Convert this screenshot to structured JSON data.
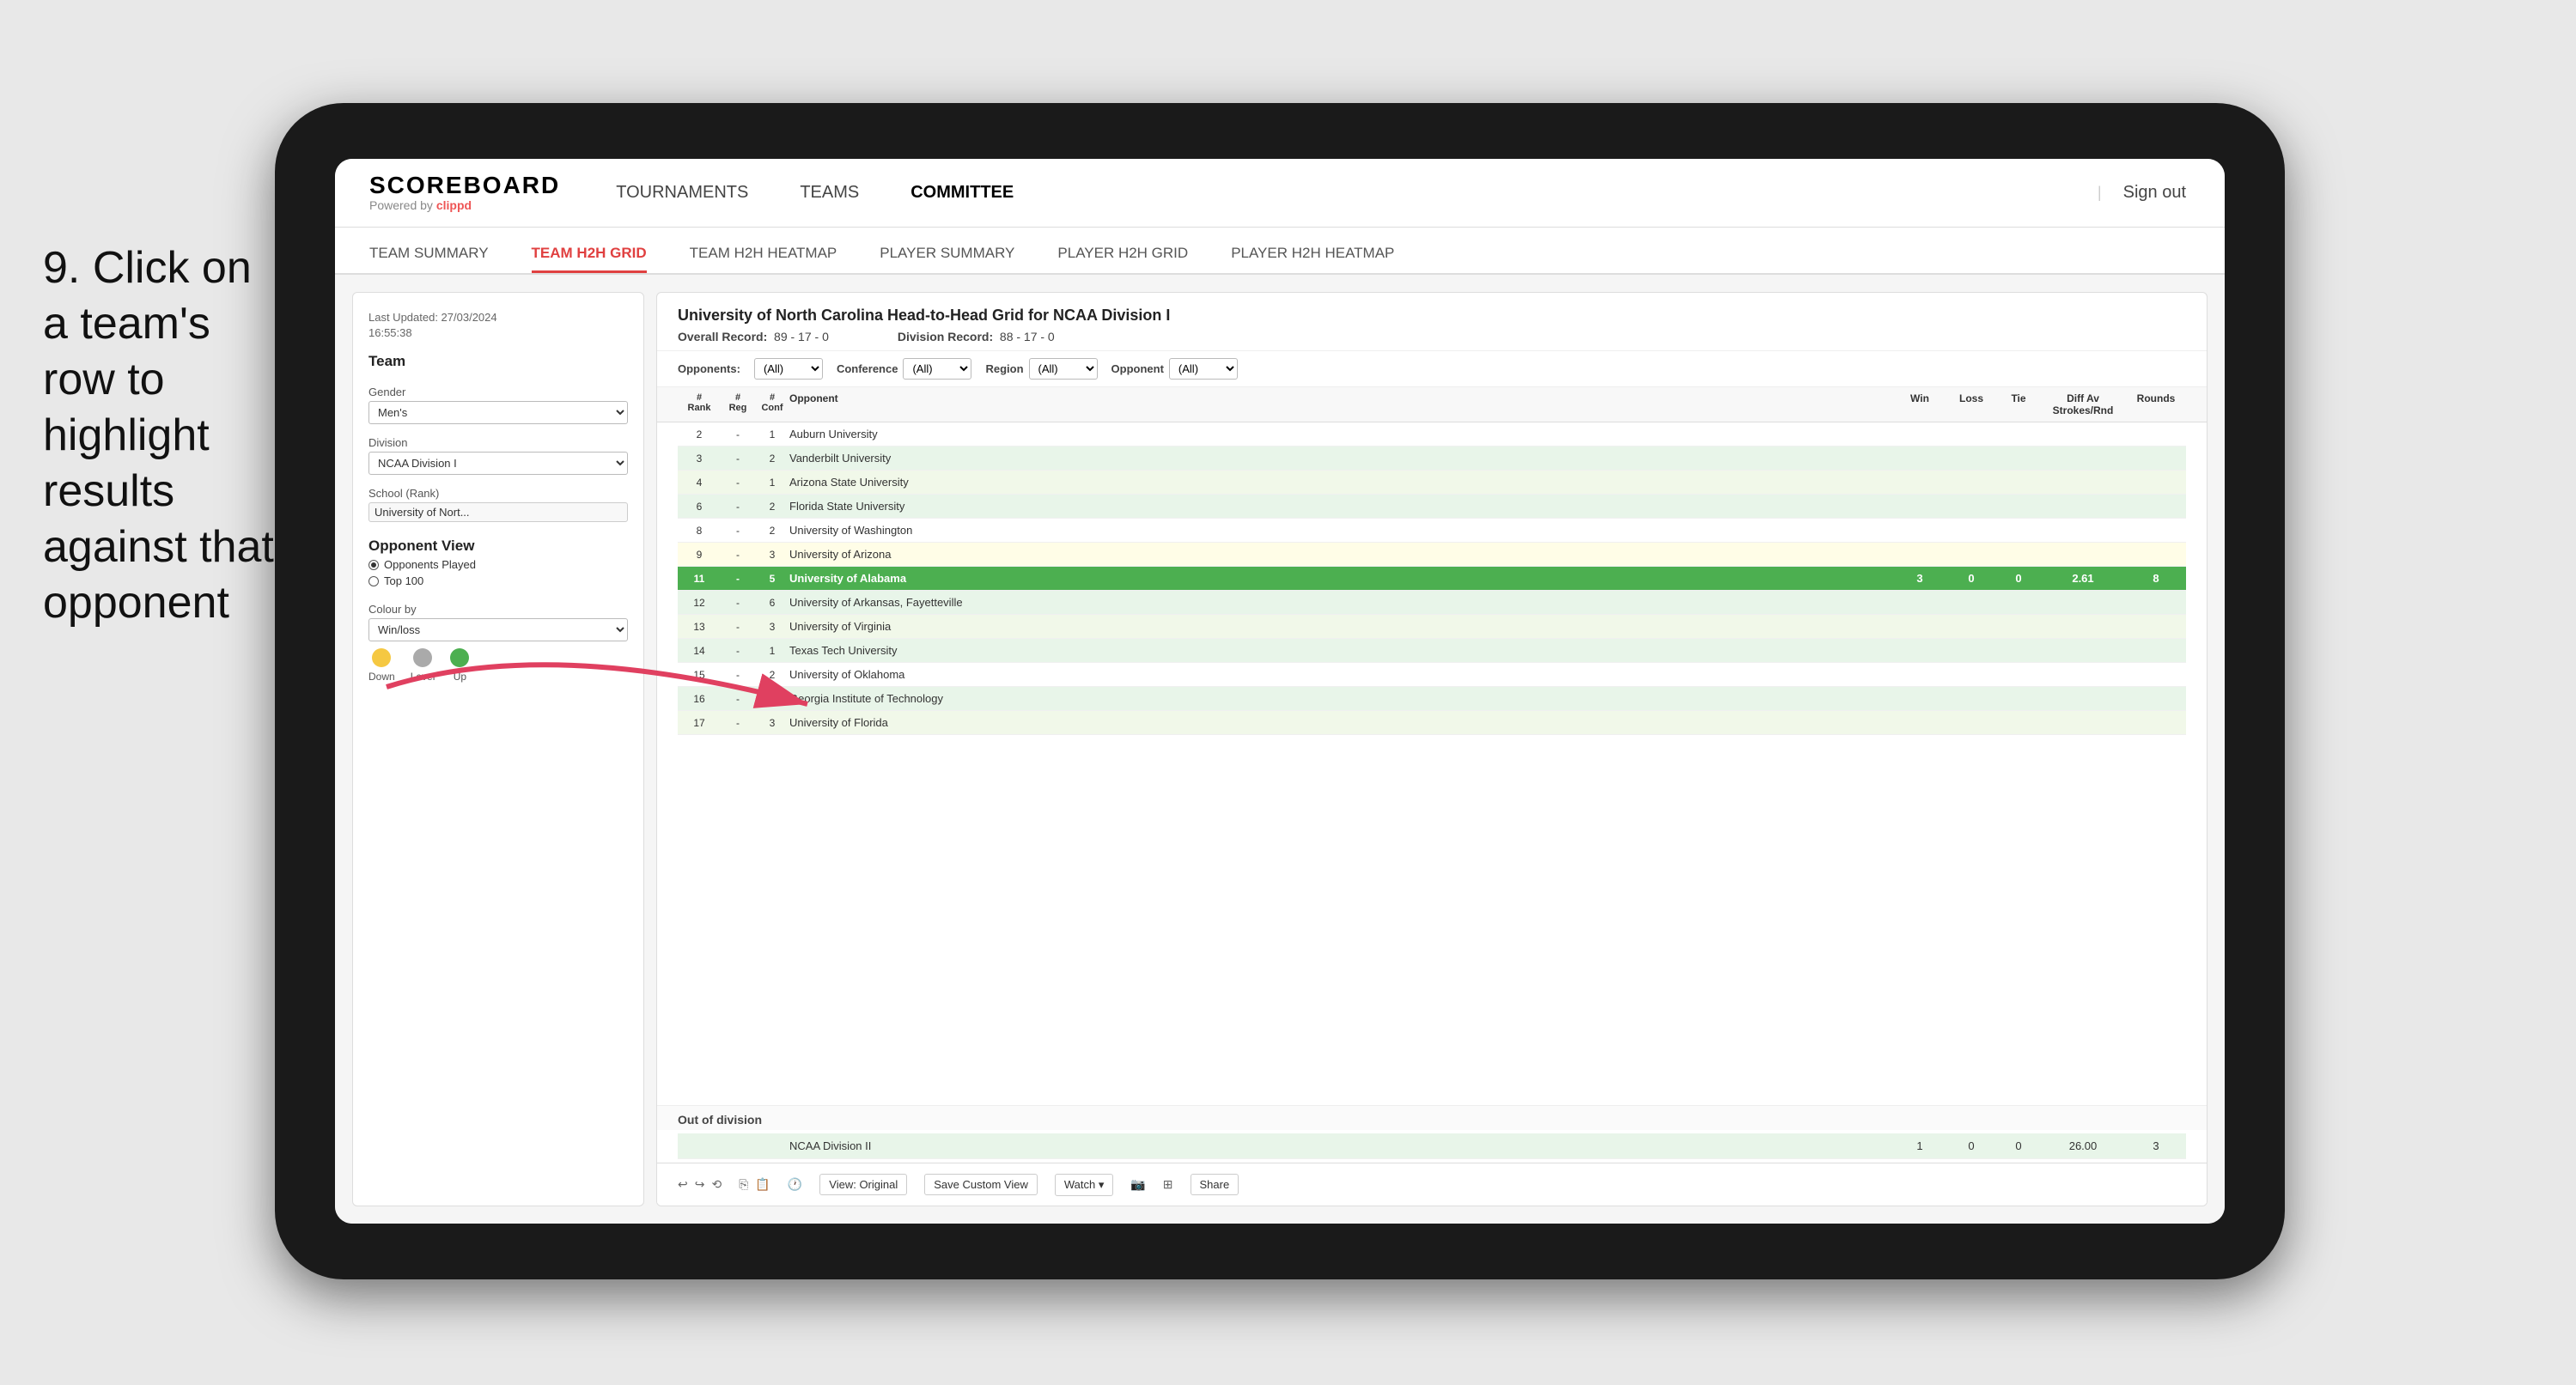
{
  "instruction": {
    "step": "9.",
    "text": "Click on a team's row to highlight results against that opponent"
  },
  "nav": {
    "logo": "SCOREBOARD",
    "logo_sub": "Powered by clippd",
    "links": [
      "TOURNAMENTS",
      "TEAMS",
      "COMMITTEE"
    ],
    "sign_out": "Sign out"
  },
  "sub_nav": {
    "items": [
      "TEAM SUMMARY",
      "TEAM H2H GRID",
      "TEAM H2H HEATMAP",
      "PLAYER SUMMARY",
      "PLAYER H2H GRID",
      "PLAYER H2H HEATMAP"
    ],
    "active": "TEAM H2H GRID"
  },
  "sidebar": {
    "timestamp_label": "Last Updated: 27/03/2024",
    "timestamp_time": "16:55:38",
    "team_label": "Team",
    "gender_label": "Gender",
    "gender_value": "Men's",
    "division_label": "Division",
    "division_value": "NCAA Division I",
    "school_label": "School (Rank)",
    "school_value": "University of Nort...",
    "opponent_view_label": "Opponent View",
    "radio_opponents": "Opponents Played",
    "radio_top100": "Top 100",
    "colour_label": "Colour by",
    "colour_value": "Win/loss",
    "colours": [
      {
        "label": "Down",
        "color": "#f5c842"
      },
      {
        "label": "Level",
        "color": "#aaa"
      },
      {
        "label": "Up",
        "color": "#4caf50"
      }
    ]
  },
  "panel": {
    "title": "University of North Carolina Head-to-Head Grid for NCAA Division I",
    "overall_record_label": "Overall Record:",
    "overall_record": "89 - 17 - 0",
    "division_record_label": "Division Record:",
    "division_record": "88 - 17 - 0",
    "opponents_label": "Opponents:",
    "opponents_value": "(All)",
    "conference_label": "Conference",
    "conference_value": "(All)",
    "region_label": "Region",
    "region_value": "(All)",
    "opponent_filter_label": "Opponent",
    "opponent_filter_value": "(All)"
  },
  "table": {
    "headers": {
      "rank": "# Rank",
      "reg": "# Reg",
      "conf": "# Conf",
      "opponent": "Opponent",
      "win": "Win",
      "loss": "Loss",
      "tie": "Tie",
      "diff": "Diff Av Strokes/Rnd",
      "rounds": "Rounds"
    },
    "rows": [
      {
        "rank": "2",
        "reg": "-",
        "conf": "1",
        "opponent": "Auburn University",
        "win": "",
        "loss": "",
        "tie": "",
        "diff": "",
        "rounds": "",
        "style": "normal"
      },
      {
        "rank": "3",
        "reg": "-",
        "conf": "2",
        "opponent": "Vanderbilt University",
        "win": "",
        "loss": "",
        "tie": "",
        "diff": "",
        "rounds": "",
        "style": "light-green"
      },
      {
        "rank": "4",
        "reg": "-",
        "conf": "1",
        "opponent": "Arizona State University",
        "win": "",
        "loss": "",
        "tie": "",
        "diff": "",
        "rounds": "",
        "style": "lighter-green"
      },
      {
        "rank": "6",
        "reg": "-",
        "conf": "2",
        "opponent": "Florida State University",
        "win": "",
        "loss": "",
        "tie": "",
        "diff": "",
        "rounds": "",
        "style": "light-green"
      },
      {
        "rank": "8",
        "reg": "-",
        "conf": "2",
        "opponent": "University of Washington",
        "win": "",
        "loss": "",
        "tie": "",
        "diff": "",
        "rounds": "",
        "style": "normal"
      },
      {
        "rank": "9",
        "reg": "-",
        "conf": "3",
        "opponent": "University of Arizona",
        "win": "",
        "loss": "",
        "tie": "",
        "diff": "",
        "rounds": "",
        "style": "pale-yellow"
      },
      {
        "rank": "11",
        "reg": "-",
        "conf": "5",
        "opponent": "University of Alabama",
        "win": "3",
        "loss": "0",
        "tie": "0",
        "diff": "2.61",
        "rounds": "8",
        "style": "highlighted"
      },
      {
        "rank": "12",
        "reg": "-",
        "conf": "6",
        "opponent": "University of Arkansas, Fayetteville",
        "win": "",
        "loss": "",
        "tie": "",
        "diff": "",
        "rounds": "",
        "style": "light-green"
      },
      {
        "rank": "13",
        "reg": "-",
        "conf": "3",
        "opponent": "University of Virginia",
        "win": "",
        "loss": "",
        "tie": "",
        "diff": "",
        "rounds": "",
        "style": "lighter-green"
      },
      {
        "rank": "14",
        "reg": "-",
        "conf": "1",
        "opponent": "Texas Tech University",
        "win": "",
        "loss": "",
        "tie": "",
        "diff": "",
        "rounds": "",
        "style": "light-green"
      },
      {
        "rank": "15",
        "reg": "-",
        "conf": "2",
        "opponent": "University of Oklahoma",
        "win": "",
        "loss": "",
        "tie": "",
        "diff": "",
        "rounds": "",
        "style": "normal"
      },
      {
        "rank": "16",
        "reg": "-",
        "conf": "4",
        "opponent": "Georgia Institute of Technology",
        "win": "",
        "loss": "",
        "tie": "",
        "diff": "",
        "rounds": "",
        "style": "light-green"
      },
      {
        "rank": "17",
        "reg": "-",
        "conf": "3",
        "opponent": "University of Florida",
        "win": "",
        "loss": "",
        "tie": "",
        "diff": "",
        "rounds": "",
        "style": "lighter-green"
      }
    ],
    "out_of_division_label": "Out of division",
    "out_of_division_row": {
      "division": "NCAA Division II",
      "win": "1",
      "loss": "0",
      "tie": "0",
      "diff": "26.00",
      "rounds": "3"
    }
  },
  "toolbar": {
    "view_label": "View: Original",
    "save_label": "Save Custom View",
    "watch_label": "Watch ▾",
    "share_label": "Share"
  }
}
